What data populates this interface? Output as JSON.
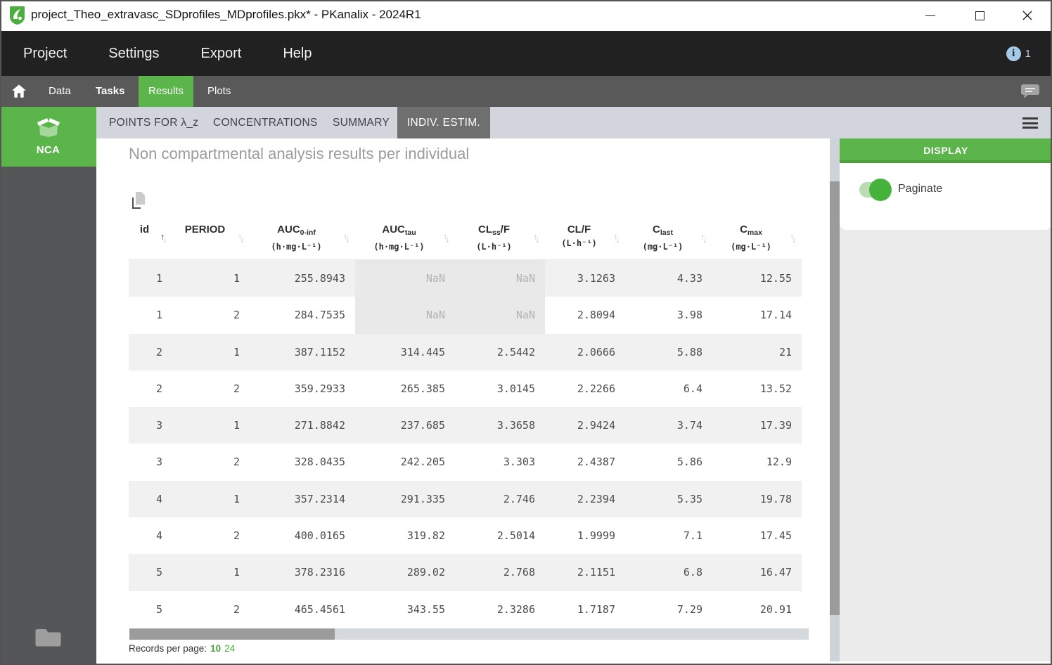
{
  "window": {
    "title": "project_Theo_extravasc_SDprofiles_MDprofiles.pkx* - PKanalix - 2024R1"
  },
  "menu": {
    "items": [
      "Project",
      "Settings",
      "Export",
      "Help"
    ],
    "notification_count": "1"
  },
  "nav": {
    "items": [
      {
        "label": "Data",
        "active": false
      },
      {
        "label": "Tasks",
        "active": false
      },
      {
        "label": "Results",
        "active": true
      },
      {
        "label": "Plots",
        "active": false
      }
    ]
  },
  "subtabs": {
    "items": [
      "POINTS FOR λ_z",
      "CONCENTRATIONS",
      "SUMMARY",
      "INDIV. ESTIM."
    ],
    "active": "INDIV. ESTIM."
  },
  "sidebar": {
    "task": "NCA"
  },
  "main": {
    "title": "Non compartmental analysis results per individual"
  },
  "table": {
    "columns": [
      {
        "key": "id",
        "base": "id",
        "sub": "",
        "suffix": "",
        "units": "",
        "sort": "asc"
      },
      {
        "key": "period",
        "base": "PERIOD",
        "sub": "",
        "suffix": "",
        "units": "",
        "sort": null
      },
      {
        "key": "auc0inf",
        "base": "AUC",
        "sub": "0-inf",
        "suffix": "",
        "units": "(h·mg·L⁻¹)",
        "sort": null
      },
      {
        "key": "auctau",
        "base": "AUC",
        "sub": "tau",
        "suffix": "",
        "units": "(h·mg·L⁻¹)",
        "sort": null
      },
      {
        "key": "clssf",
        "base": "CL",
        "sub": "ss",
        "suffix": "/F",
        "units": "(L·h⁻¹)",
        "sort": null
      },
      {
        "key": "clf",
        "base": "CL",
        "sub": "",
        "suffix": "/F",
        "units": "(L·h⁻¹)",
        "sort": null
      },
      {
        "key": "clast",
        "base": "C",
        "sub": "last",
        "suffix": "",
        "units": "(mg·L⁻¹)",
        "sort": null
      },
      {
        "key": "cmax",
        "base": "C",
        "sub": "max",
        "suffix": "",
        "units": "(mg·L⁻¹)",
        "sort": null
      }
    ],
    "rows": [
      [
        "1",
        "1",
        "255.8943",
        "NaN",
        "NaN",
        "3.1263",
        "4.33",
        "12.55"
      ],
      [
        "1",
        "2",
        "284.7535",
        "NaN",
        "NaN",
        "2.8094",
        "3.98",
        "17.14"
      ],
      [
        "2",
        "1",
        "387.1152",
        "314.445",
        "2.5442",
        "2.0666",
        "5.88",
        "21"
      ],
      [
        "2",
        "2",
        "359.2933",
        "265.385",
        "3.0145",
        "2.2266",
        "6.4",
        "13.52"
      ],
      [
        "3",
        "1",
        "271.8842",
        "237.685",
        "3.3658",
        "2.9424",
        "3.74",
        "17.39"
      ],
      [
        "3",
        "2",
        "328.0435",
        "242.205",
        "3.303",
        "2.4387",
        "5.86",
        "12.9"
      ],
      [
        "4",
        "1",
        "357.2314",
        "291.335",
        "2.746",
        "2.2394",
        "5.35",
        "19.78"
      ],
      [
        "4",
        "2",
        "400.0165",
        "319.82",
        "2.5014",
        "1.9999",
        "7.1",
        "17.45"
      ],
      [
        "5",
        "1",
        "378.2316",
        "289.02",
        "2.768",
        "2.1151",
        "6.8",
        "16.47"
      ],
      [
        "5",
        "2",
        "465.4561",
        "343.55",
        "2.3286",
        "1.7187",
        "7.29",
        "20.91"
      ]
    ]
  },
  "footer": {
    "records_label": "Records per page:",
    "options": [
      "10",
      "24"
    ],
    "selected": "10"
  },
  "display_panel": {
    "header": "DISPLAY",
    "paginate_label": "Paginate",
    "paginate_on": true
  },
  "colors": {
    "accent_green": "#5cb54a",
    "accent_green_dark": "#4c9f3c",
    "selected_subtab_bg": "#6f6f70",
    "toggle_track": "#b9dcb0",
    "toggle_knob": "#45b33b",
    "records_link_green": "#4aa73c",
    "nan_text": "#b3b3b3",
    "row_stripe": "#f1f1f1"
  }
}
